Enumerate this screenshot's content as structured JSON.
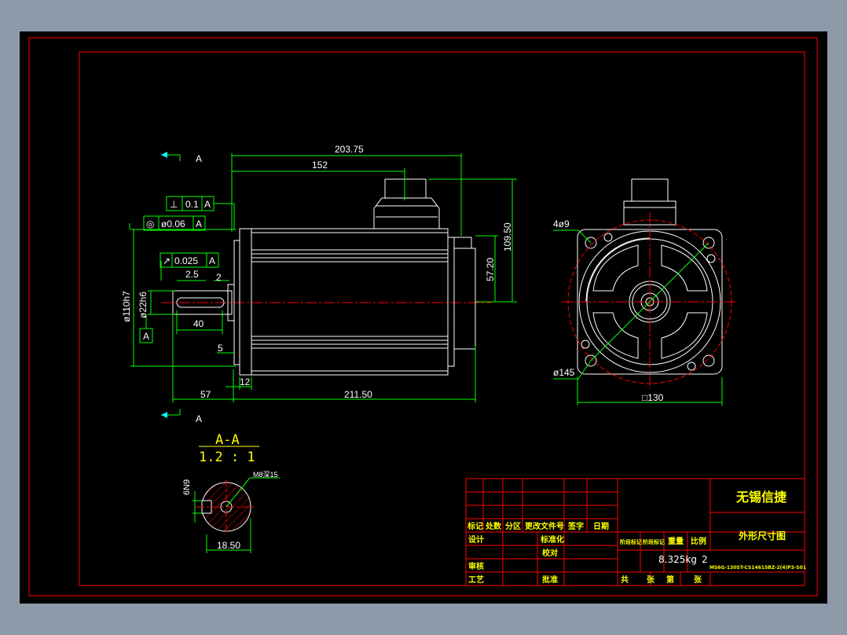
{
  "colors": {
    "background": "#000000",
    "border": "#ff0000",
    "outline": "#ffffff",
    "dimension": "#00ff00",
    "hidden": "#ff0000",
    "center": "#ff0000",
    "title_text": "#ffff00",
    "frame": "#8e9aa9"
  },
  "side_view": {
    "section_label_top": "A",
    "section_label_bottom": "A",
    "dims": {
      "overall_length": "203.75",
      "connector_pos": "152",
      "height_total": "109.50",
      "height_half": "57.20",
      "pilot_dia": "ø110h7",
      "shaft_dia": "ø22h6",
      "key_offset": "2.5",
      "key_length": "40",
      "flange_gap": "2",
      "flange_step": "5",
      "shaft_length": "57",
      "flange_thk": "12",
      "body_length": "211.50"
    },
    "tolerances": {
      "perpendicularity": {
        "symbol": "⊥",
        "value": "0.1",
        "datum": "A"
      },
      "concentricity": {
        "symbol": "◎",
        "value": "ø0.06",
        "datum": "A"
      },
      "runout": {
        "symbol": "↗",
        "value": "0.025",
        "datum": "A"
      }
    },
    "datum": "A"
  },
  "end_view": {
    "hole_callout": "4ø9",
    "pcd": "ø145",
    "square": "□130"
  },
  "section_view": {
    "title": "A-A",
    "scale": "1.2 : 1",
    "thread": "M8深15",
    "key_width": "6N9",
    "depth": "18.50"
  },
  "title_block": {
    "headers": [
      "标记",
      "处数",
      "分区",
      "更改文件号",
      "签字",
      "日期"
    ],
    "design": "设计",
    "standardize": "标准化",
    "check": "校对",
    "review": "审核",
    "process": "工艺",
    "approve": "批准",
    "stage_mark": "阶段标记",
    "weight_label": "重量",
    "scale_label": "比例",
    "weight": "8.325kg",
    "scale": "2",
    "company": "无锡信捷",
    "drawing_name": "外形尺寸图",
    "part_number": "MS6G-130ST-CS14615BZ-2(4)P3-S01",
    "sheets": [
      "共",
      "张",
      "第",
      "张"
    ]
  }
}
